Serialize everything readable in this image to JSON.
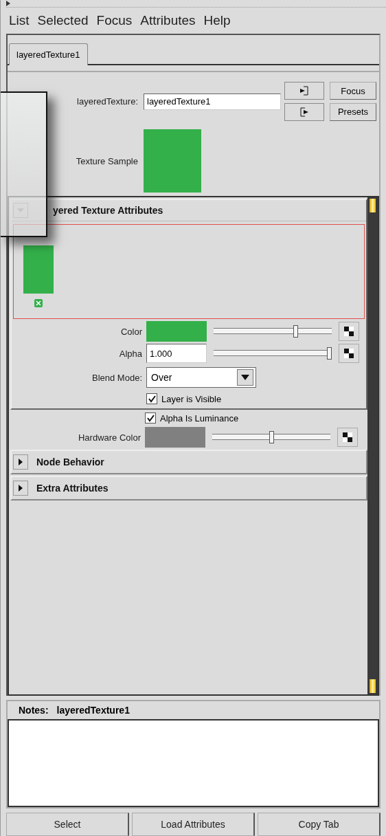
{
  "menu": [
    "List",
    "Selected",
    "Focus",
    "Attributes",
    "Help"
  ],
  "tabs": [
    {
      "label": "layeredTexture1",
      "selected": true
    }
  ],
  "node": {
    "label": "layeredTexture:",
    "value": "layeredTexture1",
    "sample_label": "Texture Sample"
  },
  "side_buttons": [
    "Focus",
    "Presets"
  ],
  "layered_section": {
    "title": "yered Texture Attributes",
    "expanded": true,
    "layers": [
      {
        "color": "#33b04a"
      }
    ],
    "rows": [
      {
        "kind": "color",
        "label": "Color",
        "color": "#33b04a",
        "level": 0.7
      },
      {
        "kind": "number",
        "label": "Alpha",
        "value": "1.000",
        "level": 1.0
      },
      {
        "kind": "dropdown",
        "label": "Blend Mode:",
        "value": "Over"
      },
      {
        "kind": "checkbox",
        "label": "Layer is Visible",
        "checked": true
      }
    ]
  },
  "rows": [
    {
      "kind": "checkbox",
      "label": "Alpha Is Luminance",
      "checked": true
    },
    {
      "kind": "color",
      "label": "Hardware Color",
      "color": "#808080",
      "level": 0.5
    }
  ],
  "collapsed_sections": [
    {
      "title": "Node Behavior",
      "expanded": false
    },
    {
      "title": "Extra Attributes",
      "expanded": false
    }
  ],
  "notes": {
    "label": "Notes:",
    "node": "layeredTexture1"
  },
  "buttons": [
    "Select",
    "Load Attributes",
    "Copy Tab"
  ]
}
